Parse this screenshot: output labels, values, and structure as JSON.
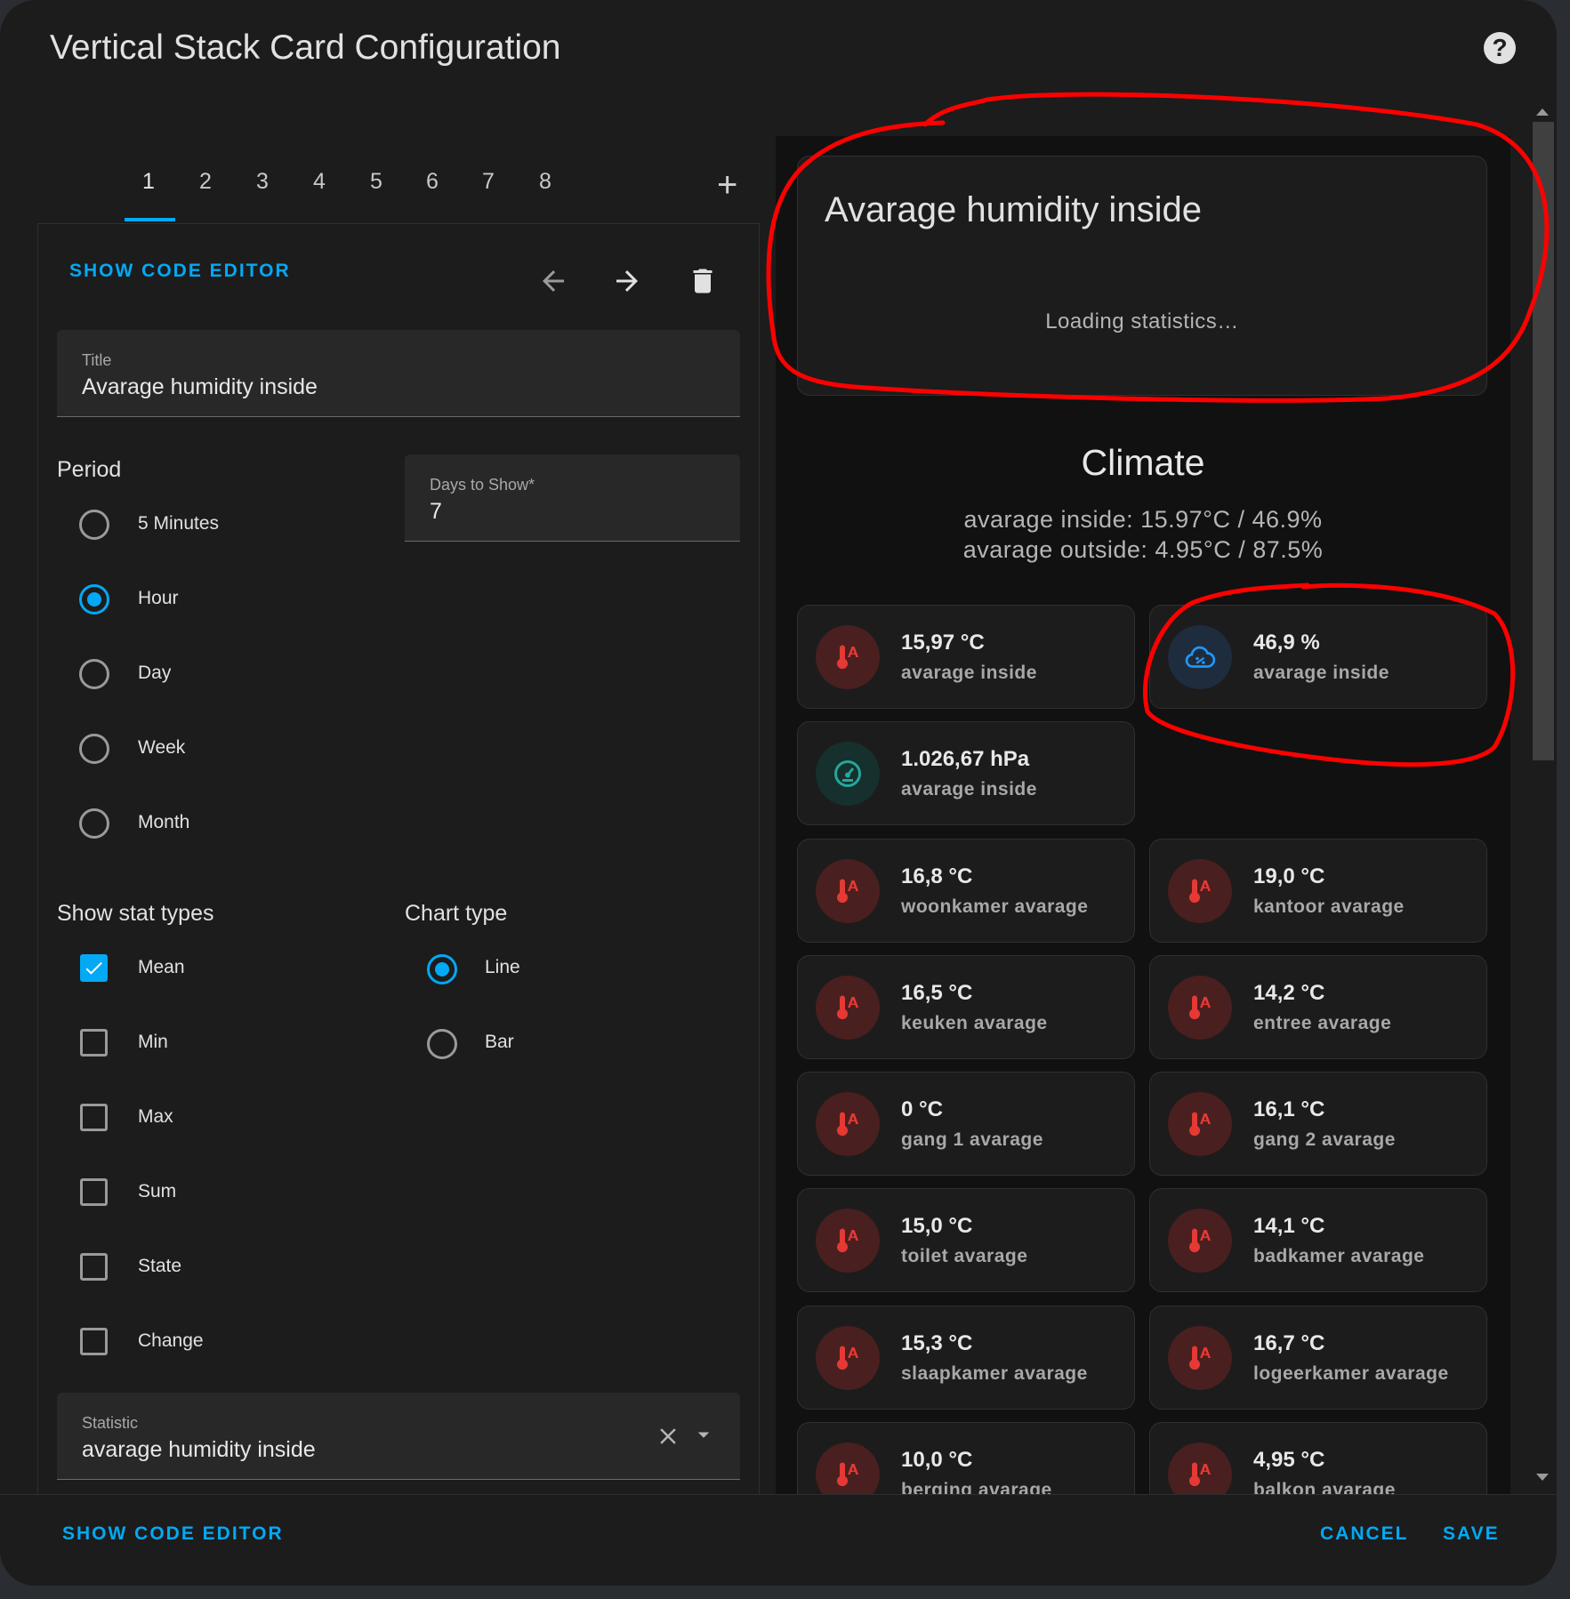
{
  "dialog": {
    "title": "Vertical Stack Card Configuration"
  },
  "tabs": [
    "1",
    "2",
    "3",
    "4",
    "5",
    "6",
    "7",
    "8"
  ],
  "editor": {
    "show_code_editor": "SHOW CODE EDITOR",
    "title_field": {
      "label": "Title",
      "value": "Avarage humidity inside"
    },
    "period": {
      "heading": "Period",
      "options": [
        "5 Minutes",
        "Hour",
        "Day",
        "Week",
        "Month"
      ],
      "selected": "Hour"
    },
    "days_field": {
      "label": "Days to Show*",
      "value": "7"
    },
    "stat_types": {
      "heading": "Show stat types",
      "options": [
        {
          "label": "Mean",
          "checked": true
        },
        {
          "label": "Min",
          "checked": false
        },
        {
          "label": "Max",
          "checked": false
        },
        {
          "label": "Sum",
          "checked": false
        },
        {
          "label": "State",
          "checked": false
        },
        {
          "label": "Change",
          "checked": false
        }
      ]
    },
    "chart_type": {
      "heading": "Chart type",
      "options": [
        "Line",
        "Bar"
      ],
      "selected": "Line"
    },
    "statistic_field": {
      "label": "Statistic",
      "value": "avarage humidity inside"
    }
  },
  "preview": {
    "stat_card": {
      "title": "Avarage humidity inside",
      "loading": "Loading statistics…"
    },
    "climate": {
      "heading": "Climate",
      "line1": "avarage inside:  15.97°C / 46.9%",
      "line2": "avarage outside: 4.95°C / 87.5%"
    },
    "tiles": [
      {
        "value": "15,97 °C",
        "name": "avarage inside",
        "icon": "thermometer-icon"
      },
      {
        "value": "46,9 %",
        "name": "avarage inside",
        "icon": "humidity-cloud-icon"
      },
      {
        "value": "1.026,67 hPa",
        "name": "avarage inside",
        "icon": "gauge-icon"
      },
      {
        "value": "16,8 °C",
        "name": "woonkamer avarage",
        "icon": "thermometer-icon"
      },
      {
        "value": "19,0 °C",
        "name": "kantoor avarage",
        "icon": "thermometer-icon"
      },
      {
        "value": "16,5 °C",
        "name": "keuken avarage",
        "icon": "thermometer-icon"
      },
      {
        "value": "14,2 °C",
        "name": "entree avarage",
        "icon": "thermometer-icon"
      },
      {
        "value": "0 °C",
        "name": "gang 1 avarage",
        "icon": "thermometer-icon"
      },
      {
        "value": "16,1 °C",
        "name": "gang 2 avarage",
        "icon": "thermometer-icon"
      },
      {
        "value": "15,0 °C",
        "name": "toilet avarage",
        "icon": "thermometer-icon"
      },
      {
        "value": "14,1 °C",
        "name": "badkamer avarage",
        "icon": "thermometer-icon"
      },
      {
        "value": "15,3 °C",
        "name": "slaapkamer avarage",
        "icon": "thermometer-icon"
      },
      {
        "value": "16,7 °C",
        "name": "logeerkamer avarage",
        "icon": "thermometer-icon"
      },
      {
        "value": "10,0 °C",
        "name": "berging avarage",
        "icon": "thermometer-icon"
      },
      {
        "value": "4,95 °C",
        "name": "balkon avarage",
        "icon": "thermometer-icon"
      }
    ]
  },
  "footer": {
    "show_code_editor": "SHOW CODE EDITOR",
    "cancel": "CANCEL",
    "save": "SAVE"
  },
  "colors": {
    "accent": "#03a9f4",
    "thermometer": "#e53935",
    "humidity": "#2196f3",
    "pressure": "#26a69a",
    "annotation": "#ff0000"
  }
}
